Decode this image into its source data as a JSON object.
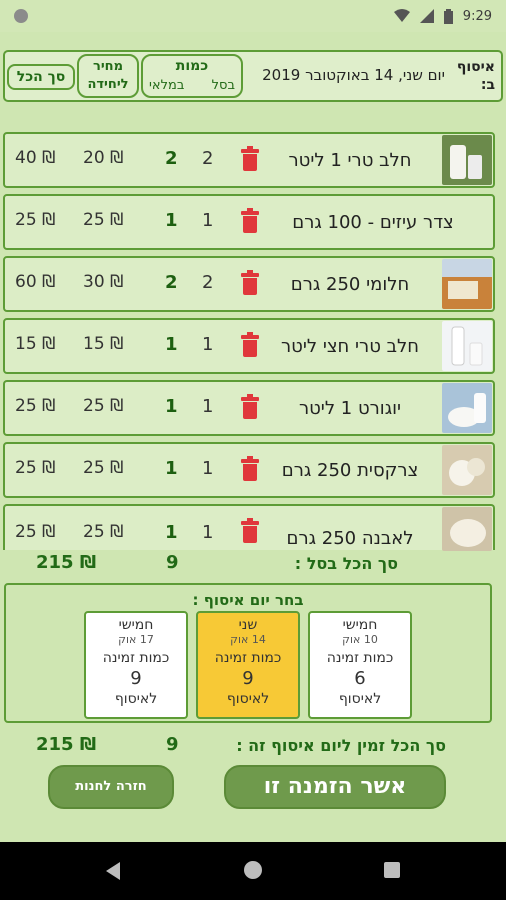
{
  "status_bar": {
    "time": "9:29",
    "icons": [
      "circle-indicator",
      "wifi-icon",
      "signal-icon",
      "battery-icon"
    ]
  },
  "header": {
    "pickup_label": "איסוף ב:",
    "date": "יום שני, 14 באוקטובר 2019",
    "quantity_title": "כמות",
    "quantity_basket": "בסל",
    "quantity_stock": "במלאי",
    "unit_price": "מחיר ליחידה",
    "total": "סך הכל"
  },
  "items": [
    {
      "name": "חלב טרי 1 ליטר",
      "qty_basket": "2",
      "qty_stock": "2",
      "unit_price": "20 ₪",
      "total": "40 ₪",
      "image": "milk-jug"
    },
    {
      "name": "צדר עיזים - 100 גרם",
      "qty_basket": "1",
      "qty_stock": "1",
      "unit_price": "25 ₪",
      "total": "25 ₪",
      "image": "goat-cheese"
    },
    {
      "name": "חלומי 250 גרם",
      "qty_basket": "2",
      "qty_stock": "2",
      "unit_price": "30 ₪",
      "total": "60 ₪",
      "image": "halloumi"
    },
    {
      "name": "חלב טרי חצי ליטר",
      "qty_basket": "1",
      "qty_stock": "1",
      "unit_price": "15 ₪",
      "total": "15 ₪",
      "image": "milk-bottle"
    },
    {
      "name": "יוגורט 1 ליטר",
      "qty_basket": "1",
      "qty_stock": "1",
      "unit_price": "25 ₪",
      "total": "25 ₪",
      "image": "yogurt"
    },
    {
      "name": "צרקסית 250 גרם",
      "qty_basket": "1",
      "qty_stock": "1",
      "unit_price": "25 ₪",
      "total": "25 ₪",
      "image": "circassian-cheese"
    },
    {
      "name": "לאבנה 250 גרם",
      "qty_basket": "1",
      "qty_stock": "1",
      "unit_price": "25 ₪",
      "total": "25 ₪",
      "image": "labneh"
    }
  ],
  "basket_summary": {
    "label": "סך הכל בסל :",
    "count": "9",
    "total": "215 ₪"
  },
  "pickup_days": {
    "title": "בחר יום איסוף :",
    "qty_label": "כמות זמינה",
    "pickup_label": "לאיסוף",
    "days": [
      {
        "day": "חמישי",
        "date": "10 אוק",
        "available": "6",
        "selected": false
      },
      {
        "day": "שני",
        "date": "14 אוק",
        "available": "9",
        "selected": true
      },
      {
        "day": "חמישי",
        "date": "17 אוק",
        "available": "9",
        "selected": false
      }
    ]
  },
  "day_summary": {
    "label": "סך הכל זמין ליום איסוף זה :",
    "count": "9",
    "total": "215 ₪"
  },
  "buttons": {
    "confirm": "אשר הזמנה זו",
    "back": "חזרה לחנות"
  },
  "colors": {
    "accent_green": "#5d9c36",
    "selected_day": "#f7c936",
    "delete_red": "#e0373b",
    "button_green": "#6f9a4c"
  }
}
